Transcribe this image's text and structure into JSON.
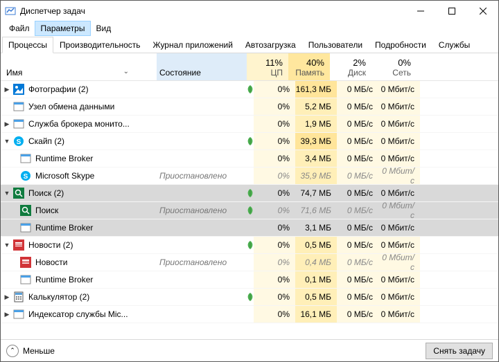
{
  "window": {
    "title": "Диспетчер задач"
  },
  "menu": {
    "file": "Файл",
    "options": "Параметры",
    "view": "Вид"
  },
  "tabs": {
    "processes": "Процессы",
    "performance": "Производительность",
    "apphistory": "Журнал приложений",
    "startup": "Автозагрузка",
    "users": "Пользователи",
    "details": "Подробности",
    "services": "Службы"
  },
  "columns": {
    "name": "Имя",
    "status": "Состояние",
    "cpu_pct": "11%",
    "cpu": "ЦП",
    "mem_pct": "40%",
    "mem": "Память",
    "disk_pct": "2%",
    "disk": "Диск",
    "net_pct": "0%",
    "net": "Сеть"
  },
  "rows": [
    {
      "kind": "group",
      "exp": "▶",
      "icon": "photos",
      "name": "Фотографии (2)",
      "leaf": true,
      "cpu": "0%",
      "mem": "161,3 МБ",
      "disk": "0 МБ/с",
      "net": "0 Мбит/с",
      "memStrong": true
    },
    {
      "kind": "group",
      "exp": "",
      "icon": "wintile",
      "name": "Узел обмена данными",
      "cpu": "0%",
      "mem": "5,2 МБ",
      "disk": "0 МБ/с",
      "net": "0 Мбит/с"
    },
    {
      "kind": "group",
      "exp": "▶",
      "icon": "wintile",
      "name": "Служба брокера монито...",
      "cpu": "0%",
      "mem": "1,9 МБ",
      "disk": "0 МБ/с",
      "net": "0 Мбит/с"
    },
    {
      "kind": "group",
      "exp": "▼",
      "icon": "skype",
      "name": "Скайп (2)",
      "leaf": true,
      "cpu": "0%",
      "mem": "39,3 МБ",
      "disk": "0 МБ/с",
      "net": "0 Мбит/с",
      "memStrong": true
    },
    {
      "kind": "child",
      "icon": "wintile",
      "name": "Runtime Broker",
      "cpu": "0%",
      "mem": "3,4 МБ",
      "disk": "0 МБ/с",
      "net": "0 Мбит/с"
    },
    {
      "kind": "child",
      "icon": "skype",
      "name": "Microsoft Skype",
      "status": "Приостановлено",
      "suspended": true,
      "cpu": "0%",
      "mem": "35,9 МБ",
      "disk": "0 МБ/с",
      "net": "0 Мбит/с"
    },
    {
      "kind": "group",
      "exp": "▼",
      "icon": "search",
      "name": "Поиск (2)",
      "leaf": true,
      "selected": true,
      "cpu": "0%",
      "mem": "74,7 МБ",
      "disk": "0 МБ/с",
      "net": "0 Мбит/с"
    },
    {
      "kind": "child",
      "icon": "search",
      "name": "Поиск",
      "status": "Приостановлено",
      "leaf": true,
      "selected": true,
      "suspended": true,
      "cpu": "0%",
      "mem": "71,6 МБ",
      "disk": "0 МБ/с",
      "net": "0 Мбит/с"
    },
    {
      "kind": "child",
      "icon": "wintile",
      "name": "Runtime Broker",
      "selected": true,
      "cpu": "0%",
      "mem": "3,1 МБ",
      "disk": "0 МБ/с",
      "net": "0 Мбит/с"
    },
    {
      "kind": "group",
      "exp": "▼",
      "icon": "news",
      "name": "Новости (2)",
      "leaf": true,
      "cpu": "0%",
      "mem": "0,5 МБ",
      "disk": "0 МБ/с",
      "net": "0 Мбит/с"
    },
    {
      "kind": "child",
      "icon": "newsred",
      "name": "Новости",
      "status": "Приостановлено",
      "suspended": true,
      "cpu": "0%",
      "mem": "0,4 МБ",
      "disk": "0 МБ/с",
      "net": "0 Мбит/с"
    },
    {
      "kind": "child",
      "icon": "wintile",
      "name": "Runtime Broker",
      "cpu": "0%",
      "mem": "0,1 МБ",
      "disk": "0 МБ/с",
      "net": "0 Мбит/с"
    },
    {
      "kind": "group",
      "exp": "▶",
      "icon": "calc",
      "name": "Калькулятор (2)",
      "leaf": true,
      "cpu": "0%",
      "mem": "0,5 МБ",
      "disk": "0 МБ/с",
      "net": "0 Мбит/с"
    },
    {
      "kind": "group",
      "exp": "▶",
      "icon": "wintile",
      "name": "Индексатор службы Mic...",
      "cpu": "0%",
      "mem": "16,1 МБ",
      "disk": "0 МБ/с",
      "net": "0 Мбит/с"
    }
  ],
  "footer": {
    "less": "Меньше",
    "endtask": "Снять задачу"
  }
}
